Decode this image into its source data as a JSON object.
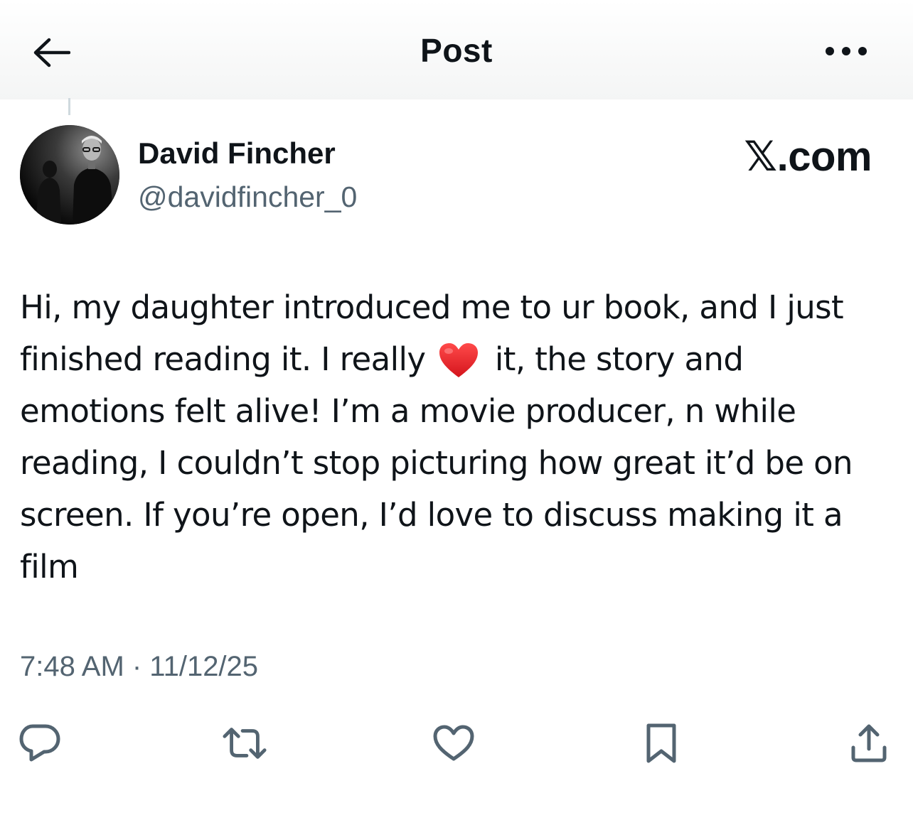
{
  "header": {
    "title": "Post",
    "back_icon": "arrow-left-icon",
    "more_icon": "more-horizontal-icon"
  },
  "author": {
    "display_name": "David Fincher",
    "handle": "@davidfincher_0",
    "avatar": "profile-photo"
  },
  "brand_label": "𝕏.com",
  "post": {
    "text_before_emoji": "Hi, my daughter introduced me to ur book, and I just finished reading it. I really",
    "emoji": "red-heart-icon",
    "text_after_emoji": " it, the story and emotions felt alive! I’m a movie producer, n while reading, I couldn’t stop picturing how great it’d be on screen. If you’re open, I’d love to discuss making it a film"
  },
  "meta": {
    "timestamp": "7:48 AM · 11/12/25"
  },
  "actions": [
    {
      "name": "reply",
      "icon": "reply-icon"
    },
    {
      "name": "repost",
      "icon": "repost-icon"
    },
    {
      "name": "like",
      "icon": "heart-icon"
    },
    {
      "name": "bookmark",
      "icon": "bookmark-icon"
    },
    {
      "name": "share",
      "icon": "share-icon"
    }
  ],
  "colors": {
    "text_primary": "#0f1419",
    "text_secondary": "#536471",
    "icon_gray": "#536471",
    "emoji_red": "#e0202a"
  }
}
